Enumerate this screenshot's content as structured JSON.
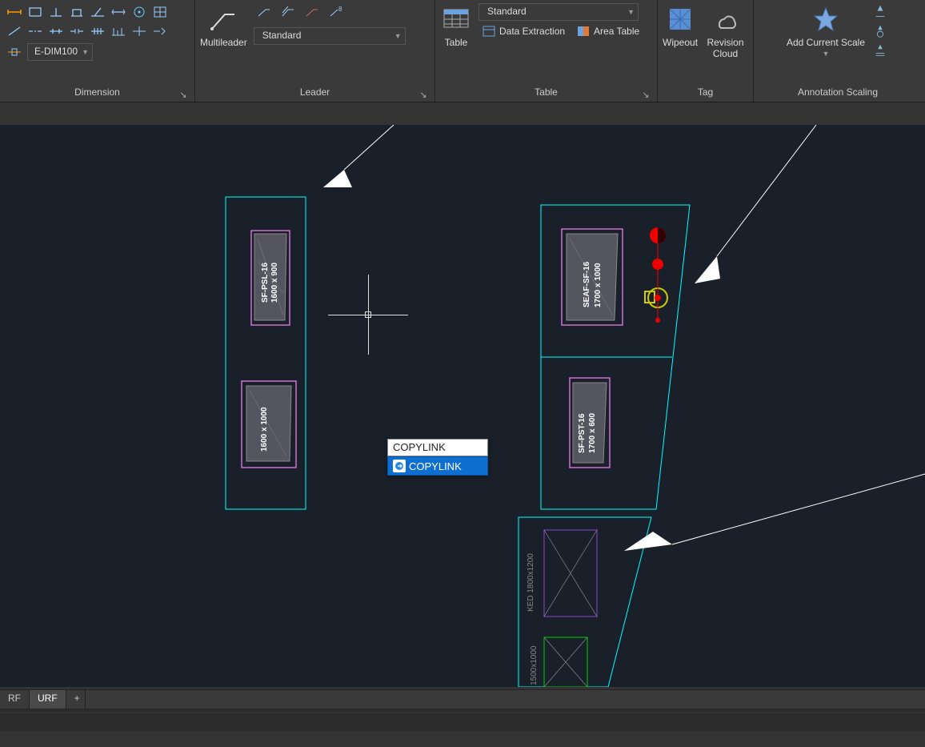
{
  "ribbon": {
    "dimension": {
      "label": "Dimension",
      "style": "E-DIM100"
    },
    "leader": {
      "label": "Leader",
      "button": "Multileader",
      "style": "Standard"
    },
    "table": {
      "label": "Table",
      "button": "Table",
      "style": "Standard",
      "data_extraction": "Data Extraction",
      "area_table": "Area Table"
    },
    "tag": {
      "label": "Tag",
      "wipeout": "Wipeout",
      "revision_cloud": "Revision Cloud"
    },
    "annotation_scaling": {
      "label": "Annotation Scaling",
      "add_current_scale": "Add Current Scale"
    }
  },
  "command": {
    "input": "COPYLINK",
    "suggestion": "COPYLINK"
  },
  "layout_tabs": {
    "tab1": "RF",
    "tab2": "URF",
    "plus": "+"
  },
  "drawing": {
    "blocks": {
      "sf_psl_16": {
        "name": "SF-PSL-16",
        "size": "1600 x 900"
      },
      "seaf_sf_16": {
        "name": "SEAF-SF-16",
        "size": "1700 x 1000"
      },
      "sf_pst_16": {
        "name": "SF-PST-16",
        "size": "1700 x 600"
      },
      "ked": {
        "label": "KED 1800x1200"
      },
      "lower": {
        "label": "1500x1000"
      },
      "unnamed": {
        "size": "1600 x 1000"
      }
    }
  }
}
